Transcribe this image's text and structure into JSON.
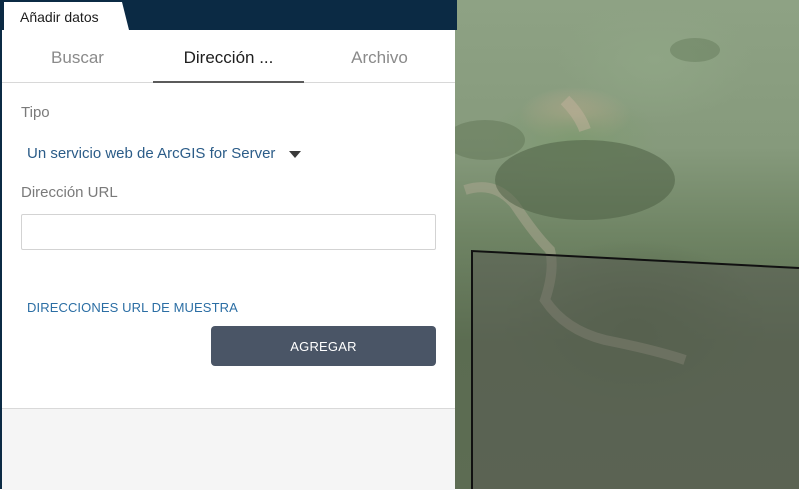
{
  "panel": {
    "title": "Añadir datos",
    "tabs": [
      {
        "label": "Buscar",
        "active": false
      },
      {
        "label": "Dirección ...",
        "active": true
      },
      {
        "label": "Archivo",
        "active": false
      }
    ]
  },
  "form": {
    "type_label": "Tipo",
    "type_value": "Un servicio web de ArcGIS for Server",
    "url_label": "Dirección URL",
    "url_value": "",
    "sample_link": "DIRECCIONES URL DE MUESTRA",
    "add_button": "AGREGAR"
  },
  "colors": {
    "header_bg": "#0b2a44",
    "link": "#2b6ea4",
    "button_bg": "#4a5566"
  }
}
